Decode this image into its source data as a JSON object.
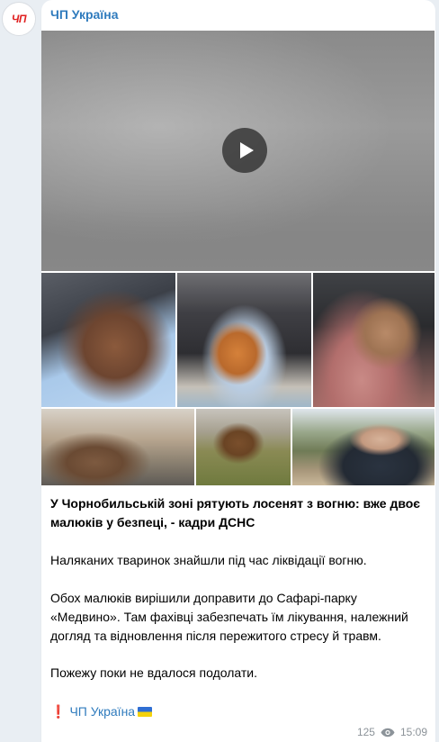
{
  "avatar": {
    "text": "ЧП"
  },
  "post": {
    "channel_name": "ЧП Україна",
    "headline": "У Чорнобильській зоні рятують лосенят з вогню: вже двоє малюків у безпеці, - кадри ДСНС",
    "paragraphs": [
      "Наляканих тваринок знайшли під час ліквідації вогню.",
      "Обох малюків вирішили доправити до Сафарі-парку «Медвино». Там фахівці забезпечать їм лікування, належний догляд та відновлення після пережитого стресу й травм.",
      "Пожежу поки не вдалося подолати."
    ],
    "footer": {
      "excl": "❗",
      "link": "ЧП Україна"
    },
    "views": "125",
    "time": "15:09"
  },
  "colors": {
    "link": "#2f7bbd",
    "accent_red": "#e02020",
    "meta": "#8c9399"
  },
  "icons": [
    "play-icon",
    "eye-icon",
    "exclamation-icon",
    "ukraine-flag-icon"
  ]
}
